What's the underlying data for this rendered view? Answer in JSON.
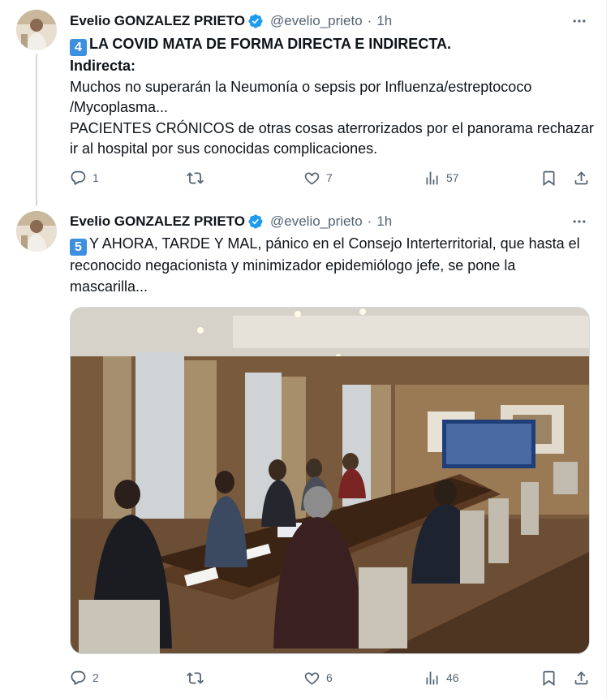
{
  "tweets": [
    {
      "display_name": "Evelio GONZALEZ PRIETO",
      "handle": "@evelio_prieto",
      "separator": "·",
      "time": "1h",
      "keycap": "4",
      "lines": [
        "LA COVID MATA DE FORMA DIRECTA E INDIRECTA.",
        "Indirecta:",
        "Muchos no superarán la Neumonía o sepsis por Influenza/estreptococo",
        "/Mycoplasma...",
        "PACIENTES CRÓNICOS de otras cosas aterrorizados por el panorama rechazar",
        "ir al hospital por sus conocidas complicaciones."
      ],
      "stats": {
        "replies": "1",
        "reposts": "",
        "likes": "7",
        "views": "57"
      }
    },
    {
      "display_name": "Evelio GONZALEZ PRIETO",
      "handle": "@evelio_prieto",
      "separator": "·",
      "time": "1h",
      "keycap": "5",
      "lines": [
        "Y AHORA, TARDE Y MAL, pánico en el Consejo Interterritorial, que hasta el",
        "reconocido negacionista y minimizador epidemiólogo jefe, se pone la",
        "mascarilla..."
      ],
      "stats": {
        "replies": "2",
        "reposts": "",
        "likes": "6",
        "views": "46"
      }
    }
  ],
  "icons": {
    "verified": "verified-badge-icon",
    "more": "more-horizontal-icon",
    "reply": "reply-icon",
    "repost": "repost-icon",
    "like": "heart-icon",
    "views": "views-icon",
    "bookmark": "bookmark-icon",
    "share": "share-icon"
  },
  "colors": {
    "text": "#0f1419",
    "secondary": "#536471",
    "verified": "#1d9bf0",
    "keycap": "#3d8fe0",
    "thread_line": "#cfd9de"
  }
}
